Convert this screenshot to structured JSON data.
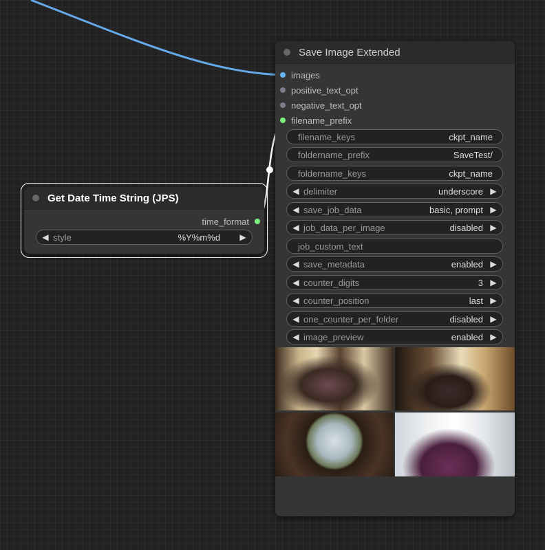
{
  "colors": {
    "image_link": "#65a9ea",
    "string_link": "#ffffff",
    "image_slot": "#64b5f6",
    "inactive_slot": "#7d7d8c",
    "string_slot": "#7cf27c"
  },
  "save_node": {
    "title": "Save Image Extended",
    "inputs": [
      "images",
      "positive_text_opt",
      "negative_text_opt",
      "filename_prefix"
    ],
    "widgets": [
      {
        "label": "filename_keys",
        "value": "ckpt_name",
        "type": "text"
      },
      {
        "label": "foldername_prefix",
        "value": "SaveTest/",
        "type": "text"
      },
      {
        "label": "foldername_keys",
        "value": "ckpt_name",
        "type": "text"
      },
      {
        "label": "delimiter",
        "value": "underscore",
        "type": "combo"
      },
      {
        "label": "save_job_data",
        "value": "basic, prompt",
        "type": "combo"
      },
      {
        "label": "job_data_per_image",
        "value": "disabled",
        "type": "combo"
      },
      {
        "label": "job_custom_text",
        "value": "",
        "type": "text"
      },
      {
        "label": "save_metadata",
        "value": "enabled",
        "type": "combo"
      },
      {
        "label": "counter_digits",
        "value": "3",
        "type": "number"
      },
      {
        "label": "counter_position",
        "value": "last",
        "type": "combo"
      },
      {
        "label": "one_counter_per_folder",
        "value": "disabled",
        "type": "combo"
      },
      {
        "label": "image_preview",
        "value": "enabled",
        "type": "combo"
      }
    ],
    "preview_images": [
      "preview-image-1",
      "preview-image-2",
      "preview-image-3",
      "preview-image-4"
    ]
  },
  "date_node": {
    "title": "Get Date Time String (JPS)",
    "output": "time_format",
    "widget": {
      "label": "style",
      "value": "%Y%m%d"
    }
  },
  "icons": {
    "left_arrow": "left-triangle-icon",
    "right_arrow": "right-triangle-icon"
  }
}
